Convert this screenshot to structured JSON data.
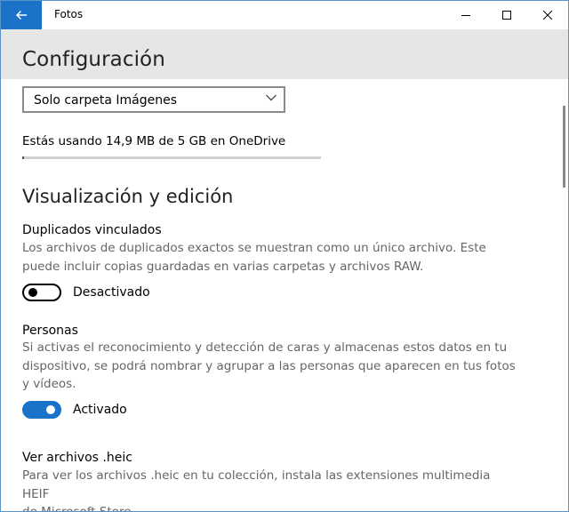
{
  "window": {
    "title": "Fotos"
  },
  "header": {
    "title": "Configuración"
  },
  "source_select": {
    "value": "Solo carpeta Imágenes"
  },
  "storage": {
    "usage_text": "Estás usando 14,9 MB de 5 GB en OneDrive",
    "used_fraction": 0.003
  },
  "section": {
    "title": "Visualización y edición"
  },
  "linked_duplicates": {
    "title": "Duplicados vinculados",
    "desc_line1": "Los archivos de duplicados exactos se muestran como un único archivo. Este",
    "desc_line2": "puede incluir copias guardadas en varias carpetas y archivos RAW.",
    "toggle_label": "Desactivado",
    "toggle_on": false
  },
  "people": {
    "title": "Personas",
    "desc_line1": "Si activas el reconocimiento y detección de caras y almacenas estos datos en tu",
    "desc_line2": "dispositivo, se podrá nombrar y agrupar a las personas que aparecen en tus fotos",
    "desc_line3": "y vídeos.",
    "toggle_label": "Activado",
    "toggle_on": true
  },
  "heic": {
    "title": "Ver archivos .heic",
    "desc_line1": "Para ver los archivos .heic en tu colección, instala las extensiones multimedia HEIF",
    "desc_line2": "de Microsoft Store."
  },
  "colors": {
    "accent": "#1a73c9",
    "header_bg": "#e6e6e6",
    "secondary_text": "#666666"
  },
  "icons": {
    "back": "back-arrow-icon",
    "minimize": "minimize-icon",
    "maximize": "maximize-icon",
    "close": "close-icon",
    "chevron": "chevron-down-icon"
  }
}
